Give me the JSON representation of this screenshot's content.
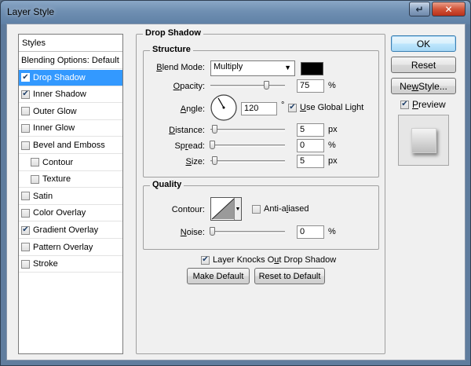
{
  "window": {
    "title": "Layer Style"
  },
  "styles_panel": {
    "header": "Styles",
    "items": [
      {
        "label": "Blending Options: Default",
        "checkbox": false,
        "checked": false,
        "selected": false,
        "sub": false
      },
      {
        "label": "Drop Shadow",
        "checkbox": true,
        "checked": true,
        "selected": true,
        "sub": false
      },
      {
        "label": "Inner Shadow",
        "checkbox": true,
        "checked": true,
        "selected": false,
        "sub": false
      },
      {
        "label": "Outer Glow",
        "checkbox": true,
        "checked": false,
        "selected": false,
        "sub": false
      },
      {
        "label": "Inner Glow",
        "checkbox": true,
        "checked": false,
        "selected": false,
        "sub": false
      },
      {
        "label": "Bevel and Emboss",
        "checkbox": true,
        "checked": false,
        "selected": false,
        "sub": false
      },
      {
        "label": "Contour",
        "checkbox": true,
        "checked": false,
        "selected": false,
        "sub": true
      },
      {
        "label": "Texture",
        "checkbox": true,
        "checked": false,
        "selected": false,
        "sub": true
      },
      {
        "label": "Satin",
        "checkbox": true,
        "checked": false,
        "selected": false,
        "sub": false
      },
      {
        "label": "Color Overlay",
        "checkbox": true,
        "checked": false,
        "selected": false,
        "sub": false
      },
      {
        "label": "Gradient Overlay",
        "checkbox": true,
        "checked": true,
        "selected": false,
        "sub": false
      },
      {
        "label": "Pattern Overlay",
        "checkbox": true,
        "checked": false,
        "selected": false,
        "sub": false
      },
      {
        "label": "Stroke",
        "checkbox": true,
        "checked": false,
        "selected": false,
        "sub": false
      }
    ]
  },
  "drop_shadow": {
    "title": "Drop Shadow",
    "structure": {
      "title": "Structure",
      "blend_mode_label_u": "B",
      "blend_mode_label_rest": "lend Mode:",
      "blend_mode_value": "Multiply",
      "shadow_color": "#000000",
      "opacity_label_u": "O",
      "opacity_label_rest": "pacity:",
      "opacity_value": "75",
      "opacity_unit": "%",
      "opacity_level": 0.75,
      "angle_label_u": "A",
      "angle_label_rest": "ngle:",
      "angle_value": "120",
      "angle_unit": "°",
      "use_global_light_label_u": "U",
      "use_global_light_label_rest": "se Global Light",
      "use_global_light_checked": true,
      "distance_label_u": "D",
      "distance_label_rest": "istance:",
      "distance_value": "5",
      "distance_unit": "px",
      "spread_label_pre": "Sp",
      "spread_label_u": "r",
      "spread_label_rest": "ead:",
      "spread_value": "0",
      "spread_unit": "%",
      "size_label_u": "S",
      "size_label_rest": "ize:",
      "size_value": "5",
      "size_unit": "px"
    },
    "quality": {
      "title": "Quality",
      "contour_label": "Contour:",
      "anti_aliased_label_pre": "Anti-a",
      "anti_aliased_label_u": "l",
      "anti_aliased_label_rest": "iased",
      "anti_aliased_checked": false,
      "noise_label_u": "N",
      "noise_label_rest": "oise:",
      "noise_value": "0",
      "noise_unit": "%"
    },
    "layer_knocks_out_label_pre": "Layer Knocks O",
    "layer_knocks_out_label_u": "u",
    "layer_knocks_out_label_rest": "t Drop Shadow",
    "layer_knocks_out_checked": true,
    "make_default_label": "Make Default",
    "reset_default_label": "Reset to Default"
  },
  "buttons": {
    "ok": "OK",
    "reset": "Reset",
    "new_style_pre": "Ne",
    "new_style_u": "w",
    "new_style_rest": " Style...",
    "preview_label_u": "P",
    "preview_label_rest": "review",
    "preview_checked": true
  }
}
